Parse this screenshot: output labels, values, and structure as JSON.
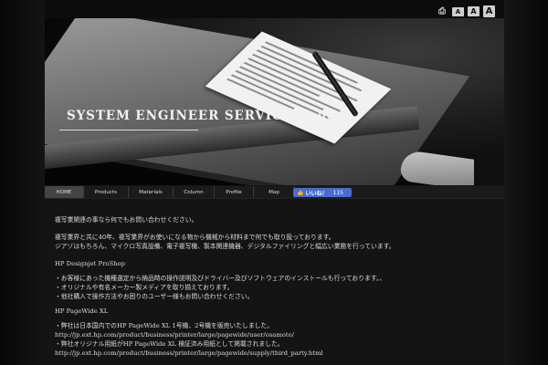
{
  "tools": {
    "icons": [
      "printer-icon"
    ],
    "sizes": [
      "A",
      "A",
      "A"
    ]
  },
  "hero": {
    "title_main": "SYSTEM ENGINEER SERVICE",
    "title_suffix": " co.,ltd."
  },
  "nav": {
    "items": [
      {
        "label": "HOME",
        "active": true
      },
      {
        "label": "Products"
      },
      {
        "label": "Materials"
      },
      {
        "label": "Column"
      },
      {
        "label": "Profile"
      },
      {
        "label": "Map"
      }
    ],
    "like": {
      "label": "いいね！",
      "count": "115"
    }
  },
  "content": {
    "intro": "複写業関連の事なら何でもお問い合わせください。",
    "about": [
      "複写業界と共に40年、複写業界がお使いになる物から機械から材料まで何でも取り扱っております。",
      "ジアゾはもちろん、マイクロ写真設備、電子複写機、製本関連機器、デジタルファイリングと幅広い業務を行っています。"
    ],
    "section1_title": "HP Designjet ProShop",
    "section1_items": [
      "・お客様にあった機種選定から納品時の操作説明及びドライバー及びソフトウェアのインストールも行っております。、",
      "・オリジナルや有名メーカー製メディアを取り揃えております。",
      "・他社購入で操作方法やお困りのユーザー様もお問い合わせください。"
    ],
    "section2_title": "HP PageWide XL",
    "section2_items": [
      "・弊社は日本国内でのHP PageWide XL 1号機、2号機を販売いたしました。",
      "http://jp.ext.hp.com/product/business/printer/large/pagewide/user/osamoto/",
      "・弊社オリジナル用紙がHP PageWide XL 検証済み用紙として掲載されました。",
      "http://jp.ext.hp.com/product/business/printer/large/pagewide/supply/third_party.html"
    ]
  }
}
